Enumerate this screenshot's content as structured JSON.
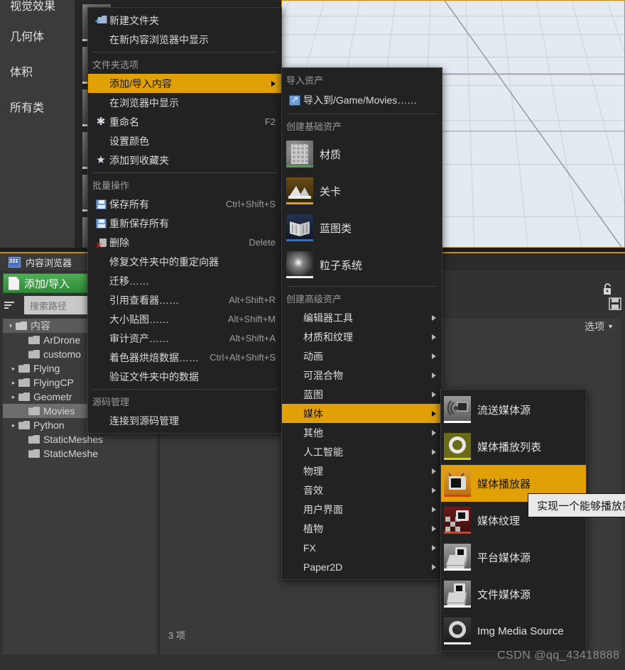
{
  "place_panel": {
    "items": [
      {
        "label": "视觉效果"
      },
      {
        "label": "几何体"
      },
      {
        "label": "体积"
      },
      {
        "label": "所有类"
      }
    ]
  },
  "content_browser": {
    "tab_label": "内容浏览器",
    "tab_icon": "content-browser-icon",
    "add_import_label": "添加/导入",
    "search_placeholder": "搜索路径",
    "filter_icon": "filter-icon",
    "lock_icon": "lock-icon",
    "save_icon": "save-icon",
    "options_label": "选项",
    "options_caret": "▼",
    "item_count": "3 项",
    "tree": [
      {
        "label": "内容",
        "depth": 0,
        "twisty": "▾",
        "selected": false
      },
      {
        "label": "ArDrone",
        "depth": 1,
        "twisty": "",
        "selected": false
      },
      {
        "label": "customo",
        "depth": 1,
        "twisty": "",
        "selected": false
      },
      {
        "label": "Flying",
        "depth": 1,
        "twisty": "▸",
        "selected": false
      },
      {
        "label": "FlyingCP",
        "depth": 1,
        "twisty": "▸",
        "selected": false
      },
      {
        "label": "Geometr",
        "depth": 1,
        "twisty": "▸",
        "selected": false
      },
      {
        "label": "Movies",
        "depth": 1,
        "twisty": "",
        "selected": true
      },
      {
        "label": "Python",
        "depth": 1,
        "twisty": "▸",
        "selected": false
      },
      {
        "label": "StaticMeshes",
        "depth": 1,
        "twisty": "",
        "selected": false
      },
      {
        "label": "StaticMeshe",
        "depth": 1,
        "twisty": "",
        "selected": false
      }
    ]
  },
  "menu1": {
    "items": [
      {
        "kind": "item",
        "icon": "new-folder-icon",
        "label": "新建文件夹",
        "shortcut": ""
      },
      {
        "kind": "item",
        "icon": "",
        "label": "在新内容浏览器中显示",
        "shortcut": ""
      },
      {
        "kind": "sep"
      },
      {
        "kind": "section",
        "label": "文件夹选项"
      },
      {
        "kind": "item",
        "icon": "",
        "label": "添加/导入内容",
        "shortcut": "",
        "highlighted": true,
        "submenu": true
      },
      {
        "kind": "item",
        "icon": "",
        "label": "在浏览器中显示",
        "shortcut": ""
      },
      {
        "kind": "item",
        "icon": "rename-icon",
        "label": "重命名",
        "shortcut": "F2"
      },
      {
        "kind": "item",
        "icon": "",
        "label": "设置颜色",
        "shortcut": ""
      },
      {
        "kind": "item",
        "icon": "star-icon",
        "label": "添加到收藏夹",
        "shortcut": ""
      },
      {
        "kind": "sep"
      },
      {
        "kind": "section",
        "label": "批量操作"
      },
      {
        "kind": "item",
        "icon": "save-icon",
        "label": "保存所有",
        "shortcut": "Ctrl+Shift+S"
      },
      {
        "kind": "item",
        "icon": "save-icon",
        "label": "重新保存所有",
        "shortcut": ""
      },
      {
        "kind": "item",
        "icon": "delete-icon",
        "label": "删除",
        "shortcut": "Delete"
      },
      {
        "kind": "item",
        "icon": "",
        "label": "修复文件夹中的重定向器",
        "shortcut": ""
      },
      {
        "kind": "item",
        "icon": "",
        "label": "迁移……",
        "shortcut": ""
      },
      {
        "kind": "item",
        "icon": "",
        "label": "引用查看器……",
        "shortcut": "Alt+Shift+R"
      },
      {
        "kind": "item",
        "icon": "",
        "label": "大小贴图……",
        "shortcut": "Alt+Shift+M"
      },
      {
        "kind": "item",
        "icon": "",
        "label": "审计资产……",
        "shortcut": "Alt+Shift+A"
      },
      {
        "kind": "item",
        "icon": "",
        "label": "着色器烘焙数据……",
        "shortcut": "Ctrl+Alt+Shift+S"
      },
      {
        "kind": "item",
        "icon": "",
        "label": "验证文件夹中的数据",
        "shortcut": ""
      },
      {
        "kind": "sep"
      },
      {
        "kind": "section",
        "label": "源码管理"
      },
      {
        "kind": "item",
        "icon": "",
        "label": "连接到源码管理",
        "shortcut": ""
      }
    ]
  },
  "menu2": {
    "section_import": "导入资产",
    "import_item": {
      "icon": "import-icon",
      "label": "导入到/Game/Movies……"
    },
    "section_basic": "创建基础资产",
    "basic_items": [
      {
        "icon": "material-thumb",
        "label": "材质"
      },
      {
        "icon": "level-thumb",
        "label": "关卡"
      },
      {
        "icon": "blueprint-thumb",
        "label": "蓝图类"
      },
      {
        "icon": "particle-thumb",
        "label": "粒子系统"
      }
    ],
    "section_advanced": "创建高级资产",
    "advanced_items": [
      {
        "label": "编辑器工具",
        "highlighted": false
      },
      {
        "label": "材质和纹理",
        "highlighted": false
      },
      {
        "label": "动画",
        "highlighted": false
      },
      {
        "label": "可混合物",
        "highlighted": false
      },
      {
        "label": "蓝图",
        "highlighted": false
      },
      {
        "label": "媒体",
        "highlighted": true
      },
      {
        "label": "其他",
        "highlighted": false
      },
      {
        "label": "人工智能",
        "highlighted": false
      },
      {
        "label": "物理",
        "highlighted": false
      },
      {
        "label": "音效",
        "highlighted": false
      },
      {
        "label": "用户界面",
        "highlighted": false
      },
      {
        "label": "植物",
        "highlighted": false
      },
      {
        "label": "FX",
        "highlighted": false
      },
      {
        "label": "Paper2D",
        "highlighted": false
      }
    ]
  },
  "menu3": {
    "items": [
      {
        "thumb": "stream-media-source-thumb",
        "label": "流送媒体源",
        "highlighted": false
      },
      {
        "thumb": "media-playlist-thumb",
        "label": "媒体播放列表",
        "highlighted": false
      },
      {
        "thumb": "media-player-thumb",
        "label": "媒体播放器",
        "highlighted": true
      },
      {
        "thumb": "media-texture-thumb",
        "label": "媒体纹理",
        "highlighted": false
      },
      {
        "thumb": "platform-media-source-thumb",
        "label": "平台媒体源",
        "highlighted": false
      },
      {
        "thumb": "file-media-source-thumb",
        "label": "文件媒体源",
        "highlighted": false
      },
      {
        "thumb": "img-media-source-thumb",
        "label": "Img Media Source",
        "highlighted": false
      }
    ]
  },
  "tooltip": {
    "text": "实现一个能够播放影"
  },
  "watermark": {
    "text": "CSDN @qq_43418888"
  },
  "colors": {
    "highlight": "#e0a006",
    "menu_bg": "#222222",
    "add_button": "#3f9a47",
    "viewport_bg": "#e3ebf0"
  }
}
